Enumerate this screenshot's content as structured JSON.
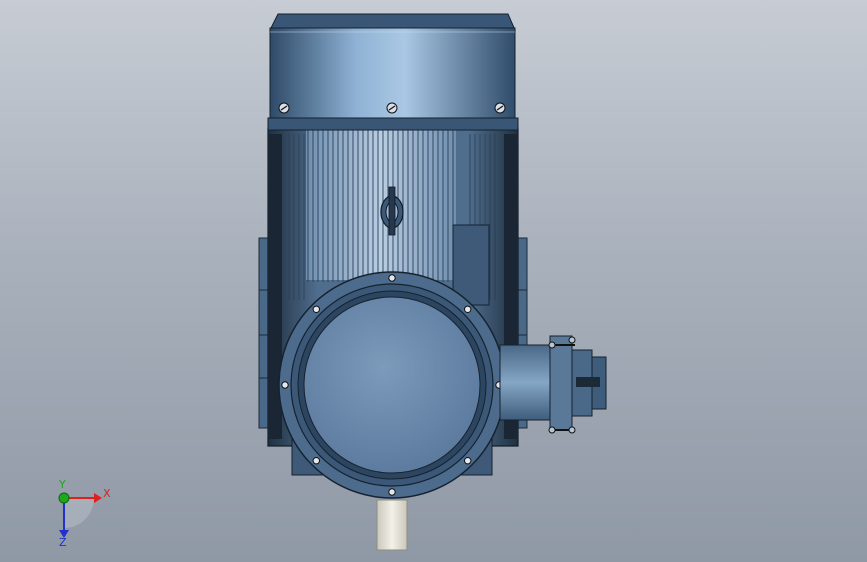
{
  "viewport": {
    "background_top": "#c7ccd4",
    "background_bottom": "#8f98a5"
  },
  "model": {
    "type": "vertical explosion-proof electric motor with junction box",
    "body_color": "#5a7898",
    "shaft_color": "#e6e4d8"
  },
  "triad": {
    "x_label": "X",
    "y_label": "Y",
    "z_label": "Z",
    "x_color": "#e0201a",
    "y_color": "#1ea81e",
    "z_color": "#2030c8"
  }
}
